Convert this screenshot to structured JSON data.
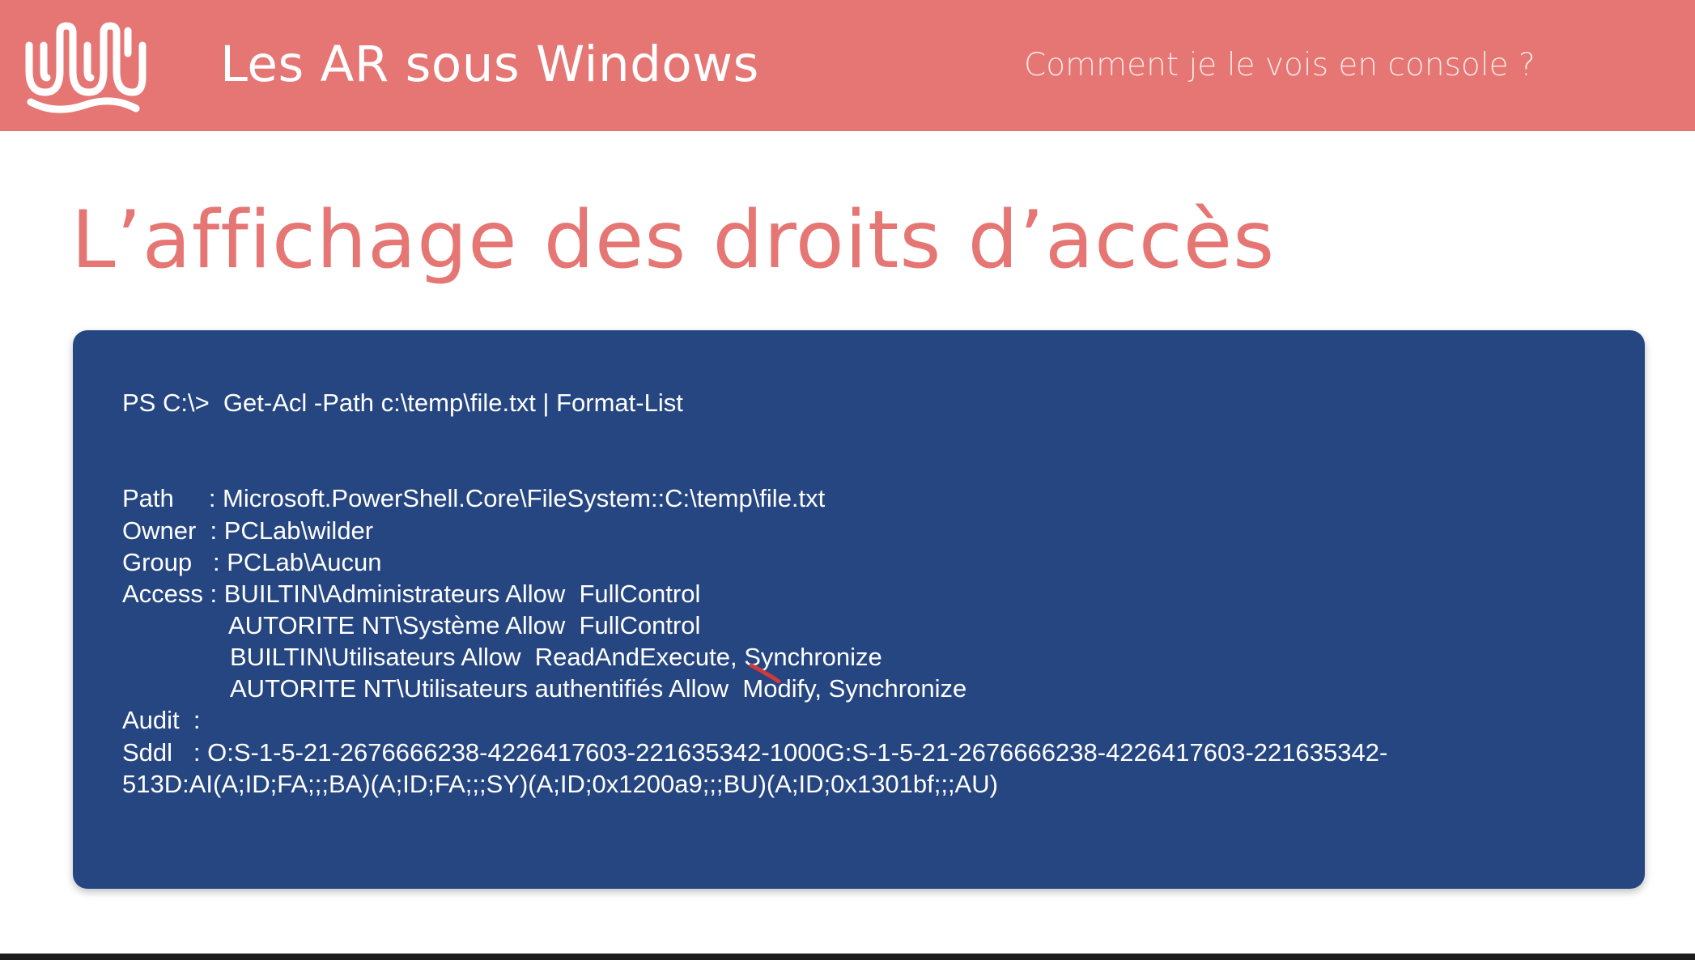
{
  "header": {
    "title": "Les AR sous Windows",
    "subtitle": "Comment je le vois en console ?",
    "logo_icon": "wild-code-school-logo-icon",
    "background_color": "#e57673"
  },
  "slide": {
    "title": "L’affichage des droits d’accès",
    "title_color": "#e57673"
  },
  "console": {
    "background_color": "#264682",
    "command": "PS C:\\>  Get-Acl -Path c:\\temp\\file.txt | Format-List",
    "path_line": "Path     : Microsoft.PowerShell.Core\\FileSystem::C:\\temp\\file.txt",
    "owner_line": "Owner  : PCLab\\wilder",
    "group_line": "Group   : PCLab\\Aucun",
    "access_lines": [
      "Access : BUILTIN\\Administrateurs Allow  FullControl",
      "AUTORITE NT\\Système Allow  FullControl",
      "BUILTIN\\Utilisateurs Allow  ReadAndExecute, Synchronize",
      "AUTORITE NT\\Utilisateurs authentifiés Allow  Modify, Synchronize"
    ],
    "audit_line": "Audit  :",
    "sddl_lines": [
      "Sddl   : O:S-1-5-21-2676666238-4226417603-221635342-1000G:S-1-5-21-2676666238-4226417603-221635342-",
      "513D:AI(A;ID;FA;;;BA)(A;ID;FA;;;SY)(A;ID;0x1200a9;;;BU)(A;ID;0x1301bf;;;AU)"
    ]
  },
  "annotation": {
    "icon": "red-pen-stroke-icon",
    "color": "#d03a3a"
  }
}
